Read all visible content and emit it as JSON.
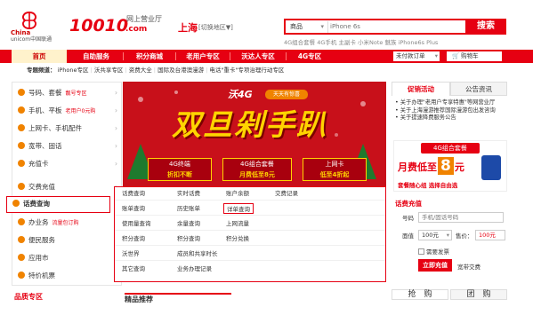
{
  "header": {
    "logo_lines": [
      "China",
      "unicom中国联通"
    ],
    "brand": "10010",
    "brand_sub": "网上营业厅",
    "brand_com": ".com",
    "city": "上海",
    "switch_label": "[切换地区▼]",
    "search": {
      "category": "商品",
      "placeholder": "iPhone 6s",
      "button": "搜索",
      "hot": "4G组合套餐  4G手机  主副卡  小米Note  魅族  iPhone6s Plus"
    }
  },
  "nav": {
    "items": [
      "首页",
      "自助服务",
      "积分商城",
      "老用户专区",
      "沃达人专区",
      "4G专区"
    ],
    "unpaid": "未付款订单",
    "cart": "购物车"
  },
  "zones": {
    "label": "专题频道：",
    "items": [
      "iPhone专区",
      "沃共享专区",
      "资费大全",
      "国际及台港澳漫游",
      "电话\"重卡\"专项治理行动专区"
    ]
  },
  "sidebar": {
    "items": [
      {
        "label": "号码、套餐",
        "mini": "靓号专区"
      },
      {
        "label": "手机、平板",
        "mini": "老用户0元购"
      },
      {
        "label": "上网卡、手机配件",
        "mini": ""
      },
      {
        "label": "宽带、固话",
        "mini": ""
      },
      {
        "label": "充值卡",
        "mini": ""
      },
      {
        "label": "交费充值",
        "mini": ""
      },
      {
        "label": "话费查询",
        "mini": ""
      },
      {
        "label": "办业务",
        "mini": "流量包订购"
      },
      {
        "label": "便民服务",
        "mini": ""
      },
      {
        "label": "应用市",
        "mini": ""
      },
      {
        "label": "特价机票",
        "mini": ""
      }
    ]
  },
  "banner": {
    "tag": "沃4G",
    "subtitle": "天天有惊喜",
    "title": "双旦剁手趴",
    "boxes": [
      {
        "top": "4G终端",
        "bottom": "折扣不断"
      },
      {
        "top": "4G组合套餐",
        "bottom": "月费低至8元"
      },
      {
        "top": "上网卡",
        "bottom": "低至4折起"
      }
    ]
  },
  "dropdown": {
    "rows": [
      {
        "head": "话费查询",
        "links": [
          "实时话费",
          "账户余额",
          "交费记录"
        ]
      },
      {
        "head": "账单查询",
        "links": [
          "历史账单",
          "详单查询"
        ]
      },
      {
        "head": "使用量查询",
        "links": [
          "余量查询",
          "上网流量"
        ]
      },
      {
        "head": "积分查询",
        "links": [
          "积分查询",
          "积分兑换"
        ]
      },
      {
        "head": "沃世界",
        "links": [
          "成员和共享时长"
        ]
      },
      {
        "head": "其它查询",
        "links": [
          "业务办理记录"
        ]
      }
    ]
  },
  "right": {
    "tabs": [
      "促销活动",
      "公告资讯"
    ],
    "news": [
      "关于办理\"老用户专享特惠\"等网营业厅",
      "关于上海漫游推荐国际漫游包出发咨询",
      "关于提速降费服务公告"
    ],
    "promo": {
      "ribbon": "4G组合套餐",
      "line": "月费低至",
      "price": "8",
      "unit": "元",
      "foot": "套餐随心组 选择自由选"
    },
    "recharge": {
      "title": "话费充值",
      "number_label": "号码",
      "number_placeholder": "手机/固话号码",
      "amount_label": "面值",
      "amount": "100元",
      "price_label": "售价：",
      "price": "100元",
      "invoice": "需要发票",
      "submit": "立即充值",
      "broadband": "宽带交费"
    }
  },
  "footer": {
    "left": "品质专区",
    "mid": "精品推荐",
    "right1": "抢　购",
    "right2": "团　购"
  },
  "colors": {
    "brand_red": "#e60012",
    "orange": "#f08300"
  }
}
